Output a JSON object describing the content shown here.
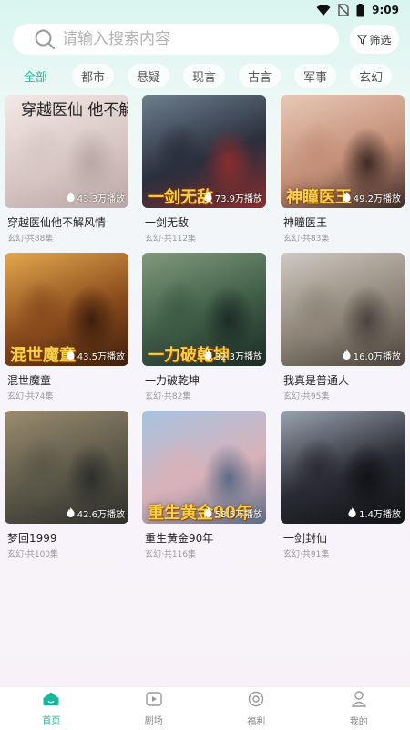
{
  "status_bar": {
    "time": "9:09"
  },
  "search": {
    "placeholder": "请输入搜索内容",
    "filter_label": "筛选"
  },
  "tabs": [
    {
      "label": "全部",
      "active": true
    },
    {
      "label": "都市",
      "active": false
    },
    {
      "label": "悬疑",
      "active": false
    },
    {
      "label": "现言",
      "active": false
    },
    {
      "label": "古言",
      "active": false
    },
    {
      "label": "军事",
      "active": false
    },
    {
      "label": "玄幻",
      "active": false
    }
  ],
  "dramas": [
    {
      "title": "穿越医仙他不解风情",
      "meta": "玄幻·共88集",
      "views": "43.3万播放",
      "poster_text": "",
      "top_text": "穿越医仙 他不解风情",
      "colors": [
        "#f3e9e6",
        "#d8c7c4",
        "#b9a7a5"
      ]
    },
    {
      "title": "一剑无敌",
      "meta": "玄幻·共112集",
      "views": "73.9万播放",
      "poster_text": "一剑无敌",
      "top_text": "",
      "colors": [
        "#6d7f8e",
        "#2a2f3d",
        "#8b2d2d"
      ]
    },
    {
      "title": "神瞳医王",
      "meta": "玄幻·共83集",
      "views": "49.2万播放",
      "poster_text": "神瞳医王",
      "top_text": "",
      "colors": [
        "#e7c9b6",
        "#c48f78",
        "#3d2a25"
      ]
    },
    {
      "title": "混世魔童",
      "meta": "玄幻·共74集",
      "views": "43.5万播放",
      "poster_text": "混世魔童",
      "top_text": "",
      "colors": [
        "#e3a84d",
        "#8a4b1d",
        "#3e1f0c"
      ]
    },
    {
      "title": "一力破乾坤",
      "meta": "玄幻·共82集",
      "views": "32.3万播放",
      "poster_text": "一力破乾坤",
      "top_text": "",
      "colors": [
        "#7f9a7c",
        "#3e5b45",
        "#1c2c26"
      ]
    },
    {
      "title": "我真是普通人",
      "meta": "玄幻·共95集",
      "views": "16.0万播放",
      "poster_text": "",
      "top_text": "",
      "colors": [
        "#cfc9c2",
        "#8f8578",
        "#4b443d"
      ]
    },
    {
      "title": "梦回1999",
      "meta": "玄幻·共100集",
      "views": "42.6万播放",
      "poster_text": "",
      "top_text": "",
      "colors": [
        "#9a8c6e",
        "#5b5748",
        "#2e2f2c"
      ]
    },
    {
      "title": "重生黄金90年",
      "meta": "玄幻·共116集",
      "views": "58.5万播放",
      "poster_text": "重生黄金90年",
      "top_text": "",
      "colors": [
        "#a7c2e0",
        "#d9b2b9",
        "#5c6b86"
      ]
    },
    {
      "title": "一剑封仙",
      "meta": "玄幻·共91集",
      "views": "1.4万播放",
      "poster_text": "",
      "top_text": "",
      "colors": [
        "#9aa3b0",
        "#2a2b33",
        "#111216"
      ]
    }
  ],
  "bottom_nav": [
    {
      "label": "首页",
      "icon": "home-icon",
      "active": true
    },
    {
      "label": "剧场",
      "icon": "play-icon",
      "active": false
    },
    {
      "label": "福利",
      "icon": "gift-icon",
      "active": false
    },
    {
      "label": "我的",
      "icon": "user-icon",
      "active": false
    }
  ],
  "accent_color": "#1ab89a"
}
